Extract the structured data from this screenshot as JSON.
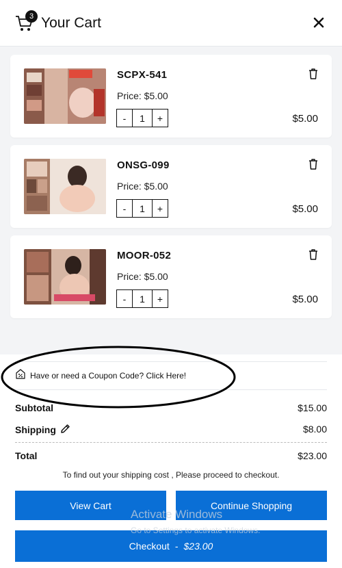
{
  "header": {
    "title": "Your Cart",
    "cart_count": "3"
  },
  "items": [
    {
      "sku": "SCPX-541",
      "price_label": "Price: $5.00",
      "quantity": "1",
      "line_total": "$5.00"
    },
    {
      "sku": "ONSG-099",
      "price_label": "Price: $5.00",
      "quantity": "1",
      "line_total": "$5.00"
    },
    {
      "sku": "MOOR-052",
      "price_label": "Price: $5.00",
      "quantity": "1",
      "line_total": "$5.00"
    }
  ],
  "coupon": {
    "text": "Have or need a Coupon Code? Click Here!"
  },
  "summary": {
    "subtotal_label": "Subtotal",
    "subtotal_value": "$15.00",
    "shipping_label": "Shipping",
    "shipping_value": "$8.00",
    "total_label": "Total",
    "total_value": "$23.00",
    "note": "To find out your shipping cost , Please proceed to checkout."
  },
  "buttons": {
    "view_cart": "View Cart",
    "continue_shopping": "Continue Shopping",
    "checkout_label": "Checkout",
    "checkout_sep": "-",
    "checkout_amount": "$23.00"
  },
  "watermark": {
    "line1": "Activate Windows",
    "line2": "Go to Settings to activate Windows."
  },
  "colors": {
    "accent": "#0a6fd6",
    "background": "#f3f4f6"
  },
  "icons": [
    "cart-icon",
    "close-icon",
    "trash-icon",
    "coupon-icon",
    "pencil-icon"
  ]
}
